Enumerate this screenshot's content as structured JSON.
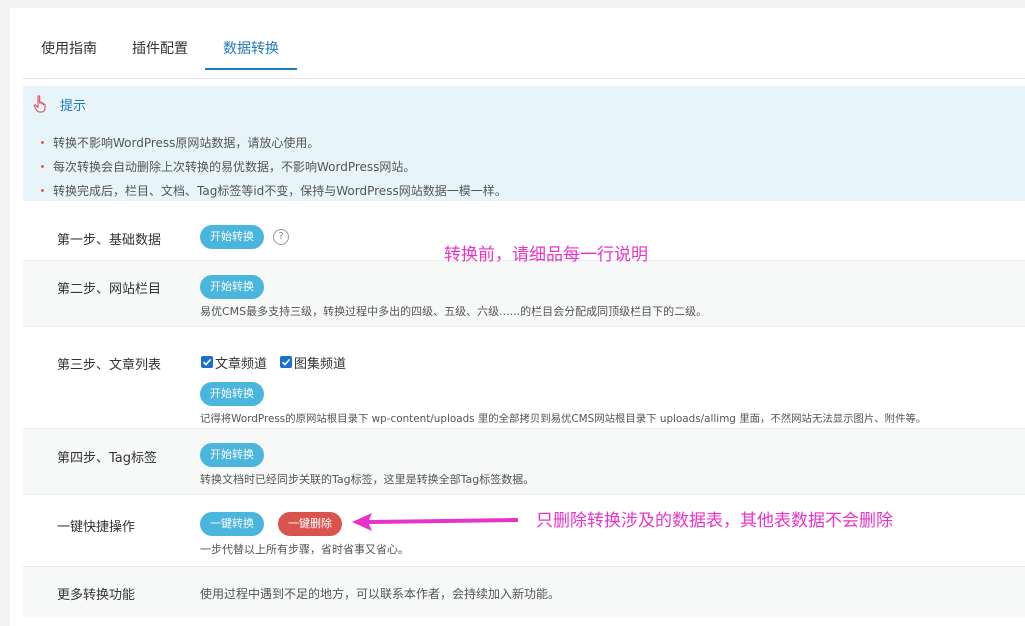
{
  "tabs": [
    {
      "label": "使用指南"
    },
    {
      "label": "插件配置"
    },
    {
      "label": "数据转换"
    }
  ],
  "tip": {
    "title": "提示",
    "lines": [
      "转换不影响WordPress原网站数据，请放心使用。",
      "每次转换会自动删除上次转换的易优数据，不影响WordPress网站。",
      "转换完成后，栏目、文档、Tag标签等id不变，保持与WordPress网站数据一模一样。"
    ]
  },
  "steps": {
    "step1": {
      "label": "第一步、基础数据",
      "button": "开始转换",
      "help": "?"
    },
    "step2": {
      "label": "第二步、网站栏目",
      "button": "开始转换",
      "desc": "易优CMS最多支持三级，转换过程中多出的四级、五级、六级......的栏目会分配成同顶级栏目下的二级。"
    },
    "step3": {
      "label": "第三步、文章列表",
      "checkbox1": "文章频道",
      "checkbox2": "图集频道",
      "button": "开始转换",
      "desc": "记得将WordPress的原网站根目录下 wp-content/uploads 里的全部拷贝到易优CMS网站根目录下 uploads/allimg 里面，不然网站无法显示图片、附件等。"
    },
    "step4": {
      "label": "第四步、Tag标签",
      "button": "开始转换",
      "desc": "转换文档时已经同步关联的Tag标签，这里是转换全部Tag标签数据。"
    },
    "quick": {
      "label": "一键快捷操作",
      "convert_button": "一键转换",
      "delete_button": "一键删除",
      "desc": "一步代替以上所有步骤，省时省事又省心。"
    },
    "more": {
      "label": "更多转换功能",
      "desc": "使用过程中遇到不足的地方，可以联系本作者，会持续加入新功能。"
    }
  },
  "annotations": {
    "top": "转换前，请细品每一行说明",
    "bottom": "只删除转换涉及的数据表，其他表数据不会删除"
  },
  "colors": {
    "accent": "#1e7bb8",
    "button_blue": "#4ab5dd",
    "button_red": "#d9534f",
    "annotation": "#e833c8",
    "tip_bg": "#e7f5fa"
  },
  "icons": {
    "tip": "hand-pointer-icon",
    "help": "question-circle-icon",
    "arrow": "arrow-left-icon"
  }
}
